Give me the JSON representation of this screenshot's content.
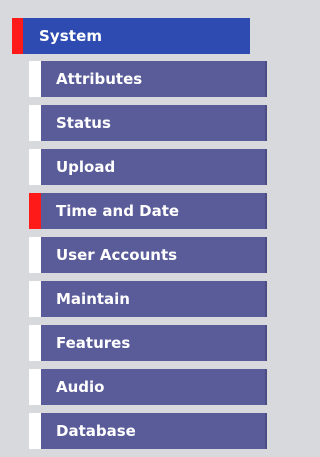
{
  "menu": {
    "top": {
      "label": "System"
    },
    "items": [
      {
        "label": "Attributes"
      },
      {
        "label": "Status"
      },
      {
        "label": "Upload"
      },
      {
        "label": "Time and Date",
        "active": true
      },
      {
        "label": "User Accounts"
      },
      {
        "label": "Maintain"
      },
      {
        "label": "Features"
      },
      {
        "label": "Audio"
      },
      {
        "label": "Database"
      }
    ]
  },
  "colors": {
    "background": "#d8d9dc",
    "top_item": "#2d4bb0",
    "sub_item": "#5a5b99",
    "marker_active": "#ff1a1a",
    "marker_inactive": "#ffffff"
  }
}
